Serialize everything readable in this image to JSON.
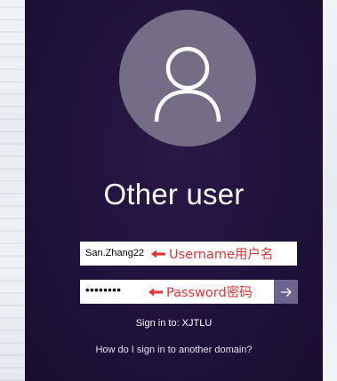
{
  "login": {
    "title": "Other user",
    "username_value": "San.Zhang22",
    "password_masked": "••••••••",
    "sign_in_to": "Sign in to: XJTLU",
    "domain_help_link": "How do I sign in to another domain?",
    "submit_icon": "arrow-right-icon",
    "avatar_icon": "user-icon"
  },
  "annotations": {
    "username_label": "Username用户名",
    "password_label": "Password密码",
    "color": "#e8312f"
  },
  "colors": {
    "panel_background": "#1f123a",
    "avatar_circle": "#756d86",
    "submit_button": "#6e6490"
  }
}
